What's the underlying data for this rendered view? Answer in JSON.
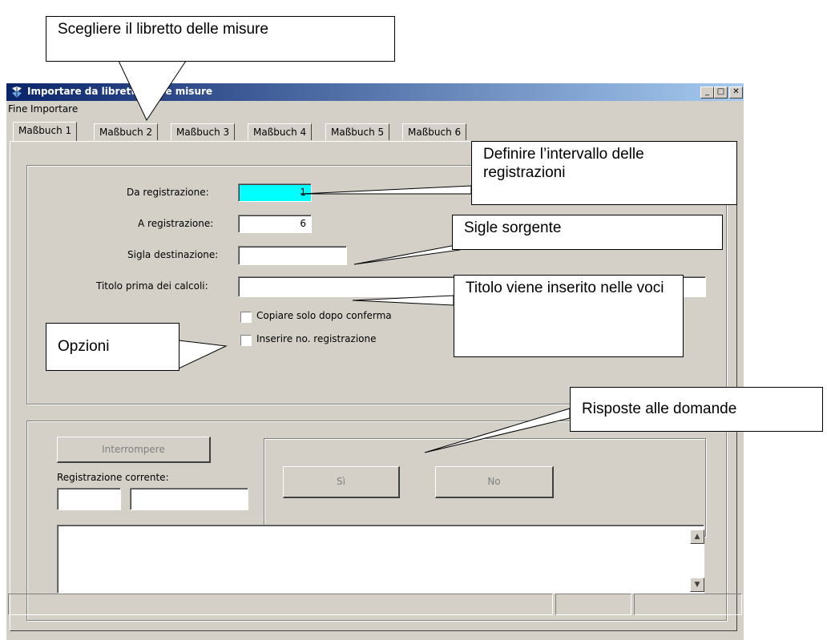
{
  "window": {
    "title": "Importare da libretto delle misure",
    "minimize": "_",
    "maximize": "□",
    "close": "✕"
  },
  "menu": {
    "items": [
      "Fine",
      "Importare"
    ]
  },
  "tabs": [
    "Maßbuch 1",
    "Maßbuch 2",
    "Maßbuch 3",
    "Maßbuch 4",
    "Maßbuch 5",
    "Maßbuch 6"
  ],
  "form": {
    "from_label": "Da registrazione:",
    "from_value": "1",
    "to_label": "A registrazione:",
    "to_value": "6",
    "dest_label": "Sigla destinazione:",
    "dest_value": "",
    "title_label": "Titolo prima dei calcoli:",
    "title_value": "",
    "opt_confirm": "Copiare solo dopo conferma",
    "opt_insert_no": "Inserire no. registrazione"
  },
  "bottom": {
    "interrupt": "Interrompere",
    "current_label": "Registrazione corrente:",
    "yes": "Sì",
    "no": "No"
  },
  "callouts": {
    "choose_book": "Scegliere il libretto delle misure",
    "define_range": "Definire l’intervallo delle registrazioni",
    "source_code": "Sigle sorgente",
    "title_inserted": "Titolo viene inserito nelle voci",
    "options": "Opzioni",
    "answers": "Risposte alle domande"
  },
  "colors": {
    "titlebar_start": "#0a246a",
    "titlebar_end": "#a6caf0",
    "focus_field": "#00ffff",
    "face": "#d4d0c8"
  }
}
